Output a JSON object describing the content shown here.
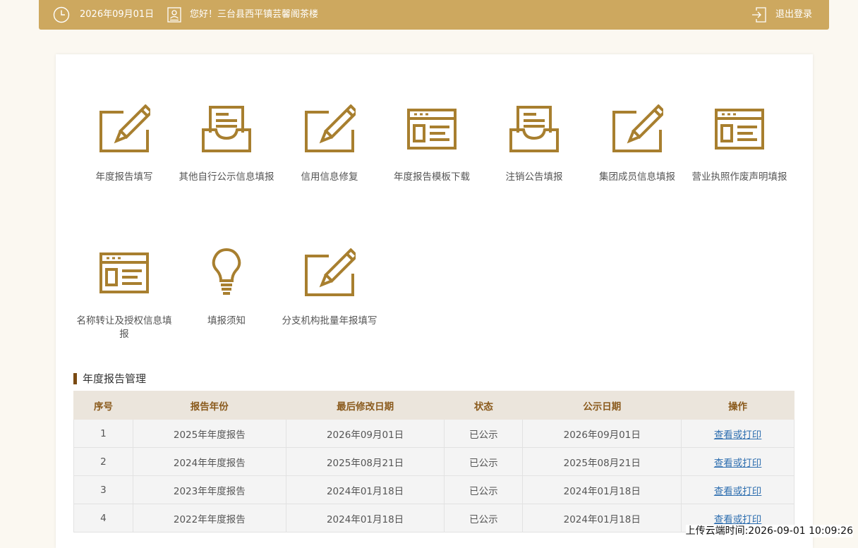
{
  "header": {
    "date": "2026年09月01日",
    "greeting": "您好！三台县西平镇芸馨阁茶楼",
    "logout_label": "退出登录"
  },
  "colors": {
    "topbar": "#cda85f",
    "icon": "#a87f2f",
    "accent": "#7a4a12",
    "link": "#2f6fb0"
  },
  "tiles": [
    {
      "label": "年度报告填写",
      "icon": "edit-pencil-icon"
    },
    {
      "label": "其他自行公示信息填报",
      "icon": "inbox-tray-icon"
    },
    {
      "label": "信用信息修复",
      "icon": "edit-pencil-icon"
    },
    {
      "label": "年度报告模板下载",
      "icon": "browser-window-icon"
    },
    {
      "label": "注销公告填报",
      "icon": "inbox-tray-icon"
    },
    {
      "label": "集团成员信息填报",
      "icon": "edit-pencil-icon"
    },
    {
      "label": "营业执照作废声明填报",
      "icon": "browser-window-icon"
    },
    {
      "label": "名称转让及授权信息填报",
      "icon": "browser-window-icon"
    },
    {
      "label": "填报须知",
      "icon": "lightbulb-icon"
    },
    {
      "label": "分支机构批量年报填写",
      "icon": "edit-pencil-icon"
    }
  ],
  "section": {
    "title": "年度报告管理"
  },
  "table": {
    "headers": [
      "序号",
      "报告年份",
      "最后修改日期",
      "状态",
      "公示日期",
      "操作"
    ],
    "rows": [
      [
        "1",
        "2025年年度报告",
        "2026年09月01日",
        "已公示",
        "2026年09月01日",
        "查看或打印"
      ],
      [
        "2",
        "2024年年度报告",
        "2025年08月21日",
        "已公示",
        "2025年08月21日",
        "查看或打印"
      ],
      [
        "3",
        "2023年年度报告",
        "2024年01月18日",
        "已公示",
        "2024年01月18日",
        "查看或打印"
      ],
      [
        "4",
        "2022年年度报告",
        "2024年01月18日",
        "已公示",
        "2024年01月18日",
        "查看或打印"
      ]
    ]
  },
  "footer": {
    "upload_time": "上传云端时间:2026-09-01 10:09:26"
  }
}
